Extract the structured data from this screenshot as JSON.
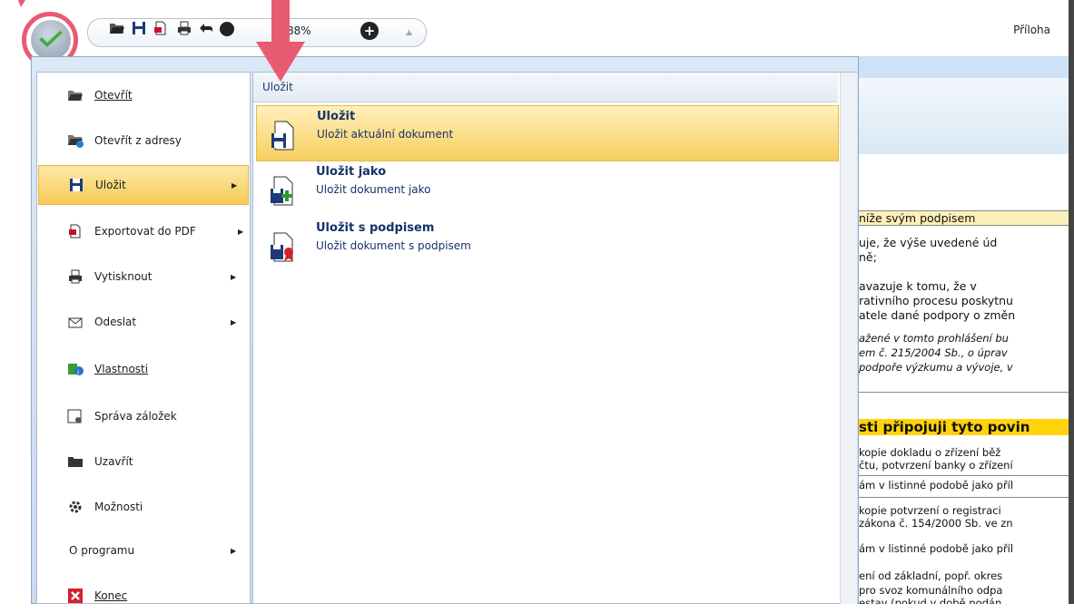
{
  "toolbar": {
    "zoom": "88%",
    "add_symbol": "+",
    "more_symbol": "⫨",
    "title": "Příloha"
  },
  "menu": {
    "items": [
      {
        "label": "Otevřít",
        "icon": "folder-open-icon"
      },
      {
        "label": "Otevřít z adresy",
        "icon": "folder-web-icon"
      },
      {
        "label": "Uložit",
        "icon": "save-icon",
        "selected": true
      },
      {
        "label": "Exportovat do PDF",
        "icon": "pdf-export-icon"
      },
      {
        "label": "Vytisknout",
        "icon": "print-icon"
      },
      {
        "label": "Odeslat",
        "icon": "send-icon"
      },
      {
        "label": "Vlastnosti",
        "icon": "properties-icon"
      },
      {
        "label": "Správa záložek",
        "icon": "bookmarks-icon"
      },
      {
        "label": "Uzavřít",
        "icon": "close-folder-icon"
      },
      {
        "label": "Možnosti",
        "icon": "gear-icon"
      },
      {
        "label": "O programu",
        "icon": ""
      },
      {
        "label": "Konec",
        "icon": "exit-icon"
      }
    ]
  },
  "submenu": {
    "header": "Uložit",
    "items": [
      {
        "title": "Uložit",
        "desc": "Uložit aktuální dokument"
      },
      {
        "title": "Uložit jako",
        "desc": "Uložit dokument jako"
      },
      {
        "title": "Uložit s podpisem",
        "desc": "Uložit dokument s podpisem"
      }
    ]
  },
  "document": {
    "lines": [
      "níže svým podpisem",
      "uje, že výše uvedené úd",
      "ně;",
      "avazuje k tomu, že v",
      "rativního procesu poskytnu",
      "atele dané podpory o změn",
      "ažené v tomto prohlášení bu",
      "em č. 215/2004 Sb., o úprav",
      "podpoře výzkumu a vývoje, v",
      "sti připojuji tyto povin",
      "kopie dokladu o zřízení běž",
      "čtu, potvrzení banky o zřízení",
      "ám v listinné podobě jako příl",
      "kopie potvrzení o registraci",
      "zákona č. 154/2000 Sb. ve zn",
      "ám v listinné podobě jako příl",
      "ení od základní, popř. okres",
      "pro svoz komunálního odpa",
      "estav (pokud v době podán"
    ]
  }
}
